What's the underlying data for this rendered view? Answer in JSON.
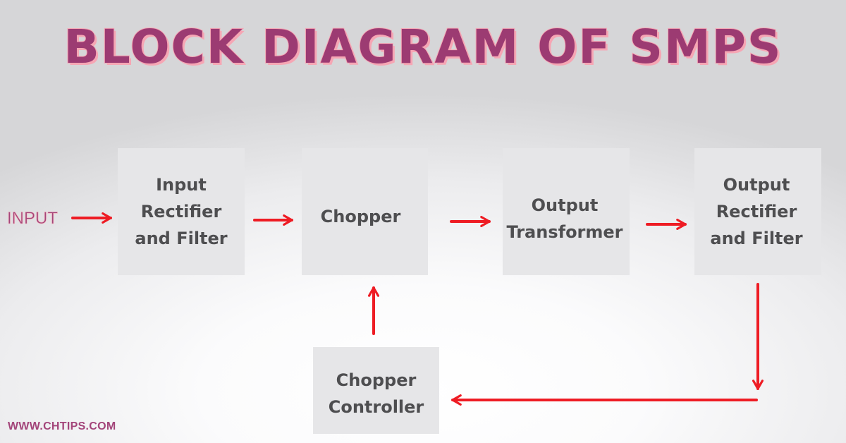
{
  "title": "BLOCK DIAGRAM OF SMPS",
  "input_label": "INPUT",
  "footer": "WWW.CHTIPS.COM",
  "blocks": {
    "input_rectifier": "Input\nRectifier\nand Filter",
    "chopper": "Chopper",
    "output_transformer": "Output\nTransformer",
    "output_rectifier": "Output\nRectifier\nand Filter",
    "chopper_controller": "Chopper\nController"
  },
  "connections": [
    {
      "from": "INPUT",
      "to": "Input Rectifier and Filter"
    },
    {
      "from": "Input Rectifier and Filter",
      "to": "Chopper"
    },
    {
      "from": "Chopper",
      "to": "Output Transformer"
    },
    {
      "from": "Output Transformer",
      "to": "Output Rectifier and Filter"
    },
    {
      "from": "Output Rectifier and Filter",
      "to": "Chopper Controller"
    },
    {
      "from": "Chopper Controller",
      "to": "Chopper"
    }
  ],
  "colors": {
    "title": "#9c3b72",
    "title_outline": "#f6a6b4",
    "arrow": "#ee1c24",
    "block_bg": "#e6e6e8",
    "block_text": "#4e4e50"
  }
}
